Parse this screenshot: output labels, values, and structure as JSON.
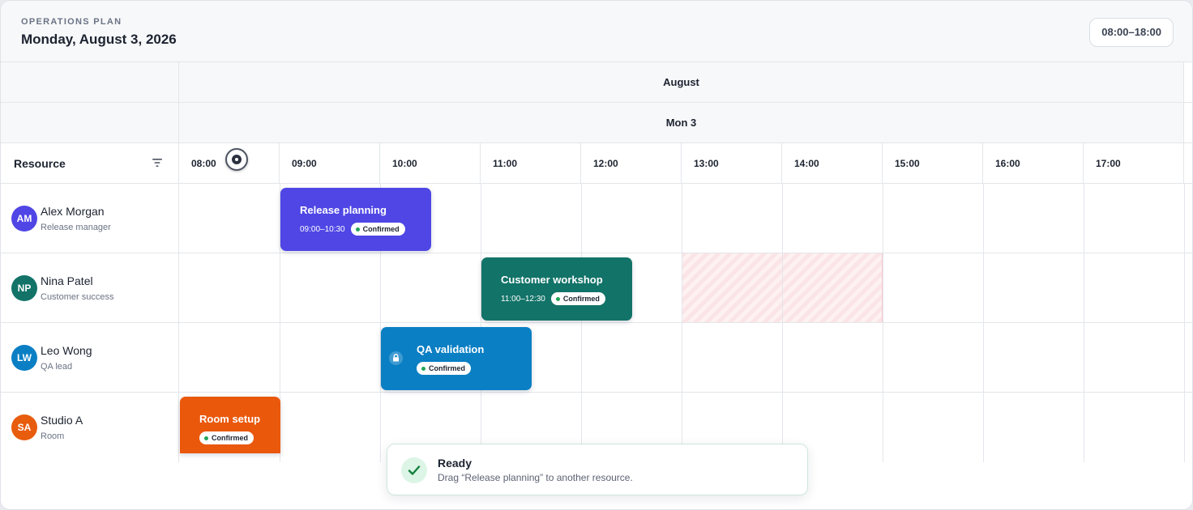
{
  "header": {
    "eyebrow": "OPERATIONS PLAN",
    "title": "Monday, August 3, 2026",
    "range": "08:00–18:00"
  },
  "timeline": {
    "month": "August",
    "day": "Mon 3",
    "resource_label": "Resource",
    "hours": [
      "08:00",
      "09:00",
      "10:00",
      "11:00",
      "12:00",
      "13:00",
      "14:00",
      "15:00",
      "16:00",
      "17:00"
    ]
  },
  "resources": [
    {
      "initials": "AM",
      "name": "Alex Morgan",
      "role": "Release manager",
      "color": "#5046e5"
    },
    {
      "initials": "NP",
      "name": "Nina Patel",
      "role": "Customer success",
      "color": "#137369"
    },
    {
      "initials": "LW",
      "name": "Leo Wong",
      "role": "QA lead",
      "color": "#0a7fc4"
    },
    {
      "initials": "SA",
      "name": "Studio A",
      "role": "Room",
      "color": "#e85c0d"
    }
  ],
  "events": [
    {
      "title": "Release planning",
      "time": "09:00–10:30",
      "status": "Confirmed",
      "color": "#4f46e5",
      "locked": false
    },
    {
      "title": "Customer workshop",
      "time": "11:00–12:30",
      "status": "Confirmed",
      "color": "#127368",
      "locked": false
    },
    {
      "title": "QA validation",
      "time": "",
      "status": "Confirmed",
      "color": "#0a7fc4",
      "locked": true
    },
    {
      "title": "Room setup",
      "time": "",
      "status": "Confirmed",
      "color": "#ea580c",
      "locked": false
    }
  ],
  "toast": {
    "title": "Ready",
    "message": "Drag “Release planning” to another resource."
  },
  "icons": {
    "filter": "filter-icon",
    "now": "now-marker-icon",
    "lock": "lock-icon",
    "check": "check-icon"
  },
  "colors": {
    "blocked": "#fbe4e6",
    "success": "#22a55b"
  }
}
